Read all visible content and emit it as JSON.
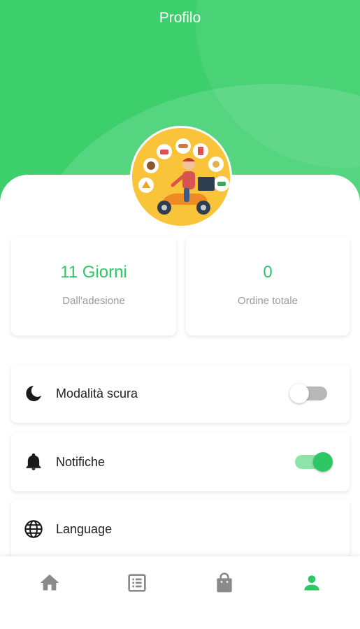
{
  "header": {
    "title": "Profilo"
  },
  "stats": [
    {
      "value": "11 Giorni",
      "label": "Dall'adesione"
    },
    {
      "value": "0",
      "label": "Ordine totale"
    }
  ],
  "settings": [
    {
      "label": "Modalità scura",
      "icon": "moon-icon",
      "toggle": false
    },
    {
      "label": "Notifiche",
      "icon": "bell-icon",
      "toggle": true
    },
    {
      "label": "Language",
      "icon": "globe-icon"
    }
  ],
  "nav": [
    {
      "icon": "home-icon",
      "active": false
    },
    {
      "icon": "orders-list-icon",
      "active": false
    },
    {
      "icon": "shopping-bag-icon",
      "active": false
    },
    {
      "icon": "profile-icon",
      "active": true
    }
  ],
  "colors": {
    "header": "#3ccf6c",
    "accent": "#2fc765",
    "icon_inactive": "#8a8a8a",
    "avatar_bg": "#f9c33a"
  }
}
